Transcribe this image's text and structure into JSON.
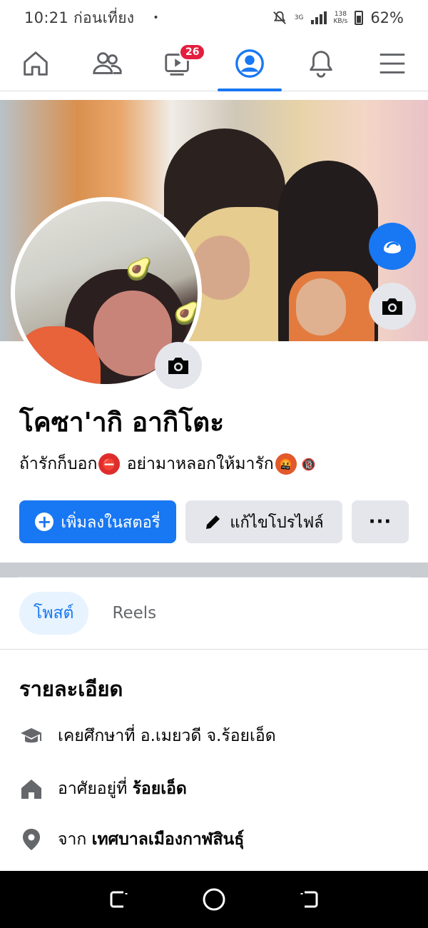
{
  "status_bar": {
    "time": "10:21 ก่อนเที่ยง",
    "dot": "•",
    "network": "3G",
    "speed_value": "138",
    "speed_unit": "KB/s",
    "battery": "62%"
  },
  "nav": {
    "video_badge": "26",
    "active_tab": "profile"
  },
  "profile": {
    "name": "โคซา'ากิ อากิโตะ",
    "bio_part1": "ถ้ารักก็บอก",
    "bio_emoji1": "⛔",
    "bio_part2": " อย่ามาหลอกให้มารัก",
    "bio_emoji2": "🤬",
    "bio_emoji3": "🔞"
  },
  "actions": {
    "add_story": "เพิ่มลงในสตอรี่",
    "edit_profile": "แก้ไขโปรไฟล์",
    "more": "···"
  },
  "tabs": [
    {
      "label": "โพสต์",
      "active": true
    },
    {
      "label": "Reels",
      "active": false
    }
  ],
  "details": {
    "title": "รายละเอียด",
    "education_prefix": "เคยศึกษาที่ อ.เมยวดี จ.ร้อยเอ็ด",
    "lives_prefix": "อาศัยอยู่ที่ ",
    "lives_value": "ร้อยเอ็ด",
    "from_prefix": "จาก ",
    "from_value": "เทศบาลเมืองกาฬสินธุ์"
  },
  "colors": {
    "accent": "#1877f2",
    "badge": "#e41e3f"
  }
}
